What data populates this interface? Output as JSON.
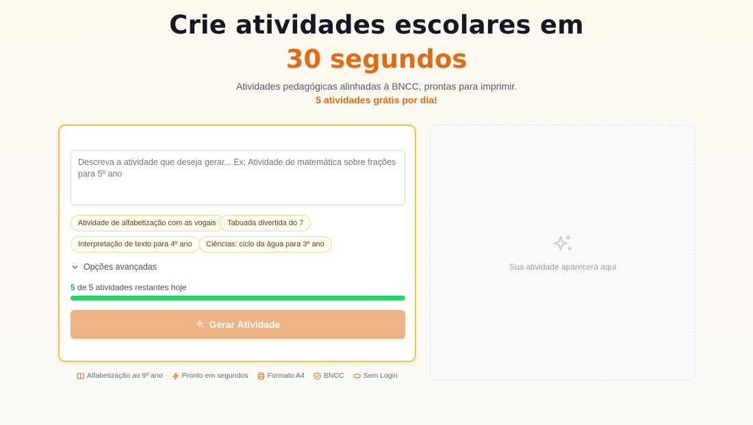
{
  "hero": {
    "title": "Crie atividades escolares em",
    "accent": "30 segundos",
    "subtitle": "Atividades pedagógicas alinhadas à BNCC, prontas para imprimir.",
    "free_note": "5 atividades grátis por dia!"
  },
  "form": {
    "prompt_placeholder": "Descreva a atividade que deseja gerar... Ex: Atividade de matemática sobre frações para 5º ano",
    "prompt_value": "",
    "suggestions": [
      {
        "label": "Atividade de alfabetização com as vogais"
      },
      {
        "label": "Tabuada divertida do 7"
      },
      {
        "label": "Interpretação de texto para 4º ano"
      },
      {
        "label": "Ciências: ciclo da água para 3º ano"
      }
    ],
    "advanced_label": "Opções avançadas",
    "remaining_count": "5",
    "remaining_text": "de 5 atividades restantes hoje",
    "progress_fraction": 1.0,
    "generate_label": "Gerar Atividade"
  },
  "features": [
    {
      "icon": "book-icon",
      "label": "Alfabetização ao 9º ano"
    },
    {
      "icon": "lightning-icon",
      "label": "Pronto em segundos"
    },
    {
      "icon": "printer-icon",
      "label": "Formato A4"
    },
    {
      "icon": "check-circle-icon",
      "label": "BNCC"
    },
    {
      "icon": "mask-icon",
      "label": "Sem Login"
    }
  ],
  "preview": {
    "icon": "sparkles-icon",
    "hint": "Sua atividade aparecerá aqui"
  },
  "colors": {
    "accent": "#e26b12",
    "border": "#f2c14a",
    "progress": "#22d660",
    "button": "#ecb384"
  }
}
